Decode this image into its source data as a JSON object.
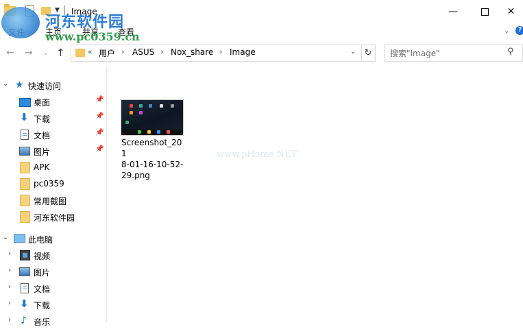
{
  "window": {
    "title": "Image"
  },
  "watermark": {
    "name": "河东软件园",
    "url": "www.pc0359.cn",
    "center_text": "www.pHome.NET"
  },
  "ribbon": {
    "tabs": [
      "文件",
      "主页",
      "共享",
      "查看"
    ],
    "help": "?"
  },
  "window_controls": {
    "minimize": "—",
    "maximize": "",
    "close": "✕"
  },
  "nav": {
    "back": "←",
    "forward": "→",
    "up": "↑",
    "breadcrumb_prefix": "«",
    "breadcrumb": [
      "用户",
      "ASUS",
      "Nox_share",
      "Image"
    ],
    "separator": "›",
    "refresh": "↻"
  },
  "search": {
    "placeholder": "搜索\"Image\""
  },
  "sidebar": {
    "quick_access": {
      "label": "快速访问",
      "items": [
        {
          "label": "桌面",
          "icon": "desktop-icon",
          "pinned": true
        },
        {
          "label": "下载",
          "icon": "download-icon",
          "pinned": true
        },
        {
          "label": "文档",
          "icon": "document-icon",
          "pinned": true
        },
        {
          "label": "图片",
          "icon": "pictures-icon",
          "pinned": true
        },
        {
          "label": "APK",
          "icon": "folder-icon",
          "pinned": false
        },
        {
          "label": "pc0359",
          "icon": "folder-icon",
          "pinned": false
        },
        {
          "label": "常用截图",
          "icon": "folder-icon",
          "pinned": false
        },
        {
          "label": "河东软件园",
          "icon": "folder-icon",
          "pinned": false
        }
      ]
    },
    "this_pc": {
      "label": "此电脑",
      "items": [
        {
          "label": "视频",
          "icon": "video-icon"
        },
        {
          "label": "图片",
          "icon": "pictures-icon"
        },
        {
          "label": "文档",
          "icon": "document-icon"
        },
        {
          "label": "下载",
          "icon": "download-icon"
        },
        {
          "label": "音乐",
          "icon": "music-icon"
        }
      ]
    }
  },
  "files": [
    {
      "name": "Screenshot_2018-01-16-10-52-29.png",
      "name_lines": [
        "Screenshot_201",
        "8-01-16-10-52-",
        "29.png"
      ]
    }
  ]
}
